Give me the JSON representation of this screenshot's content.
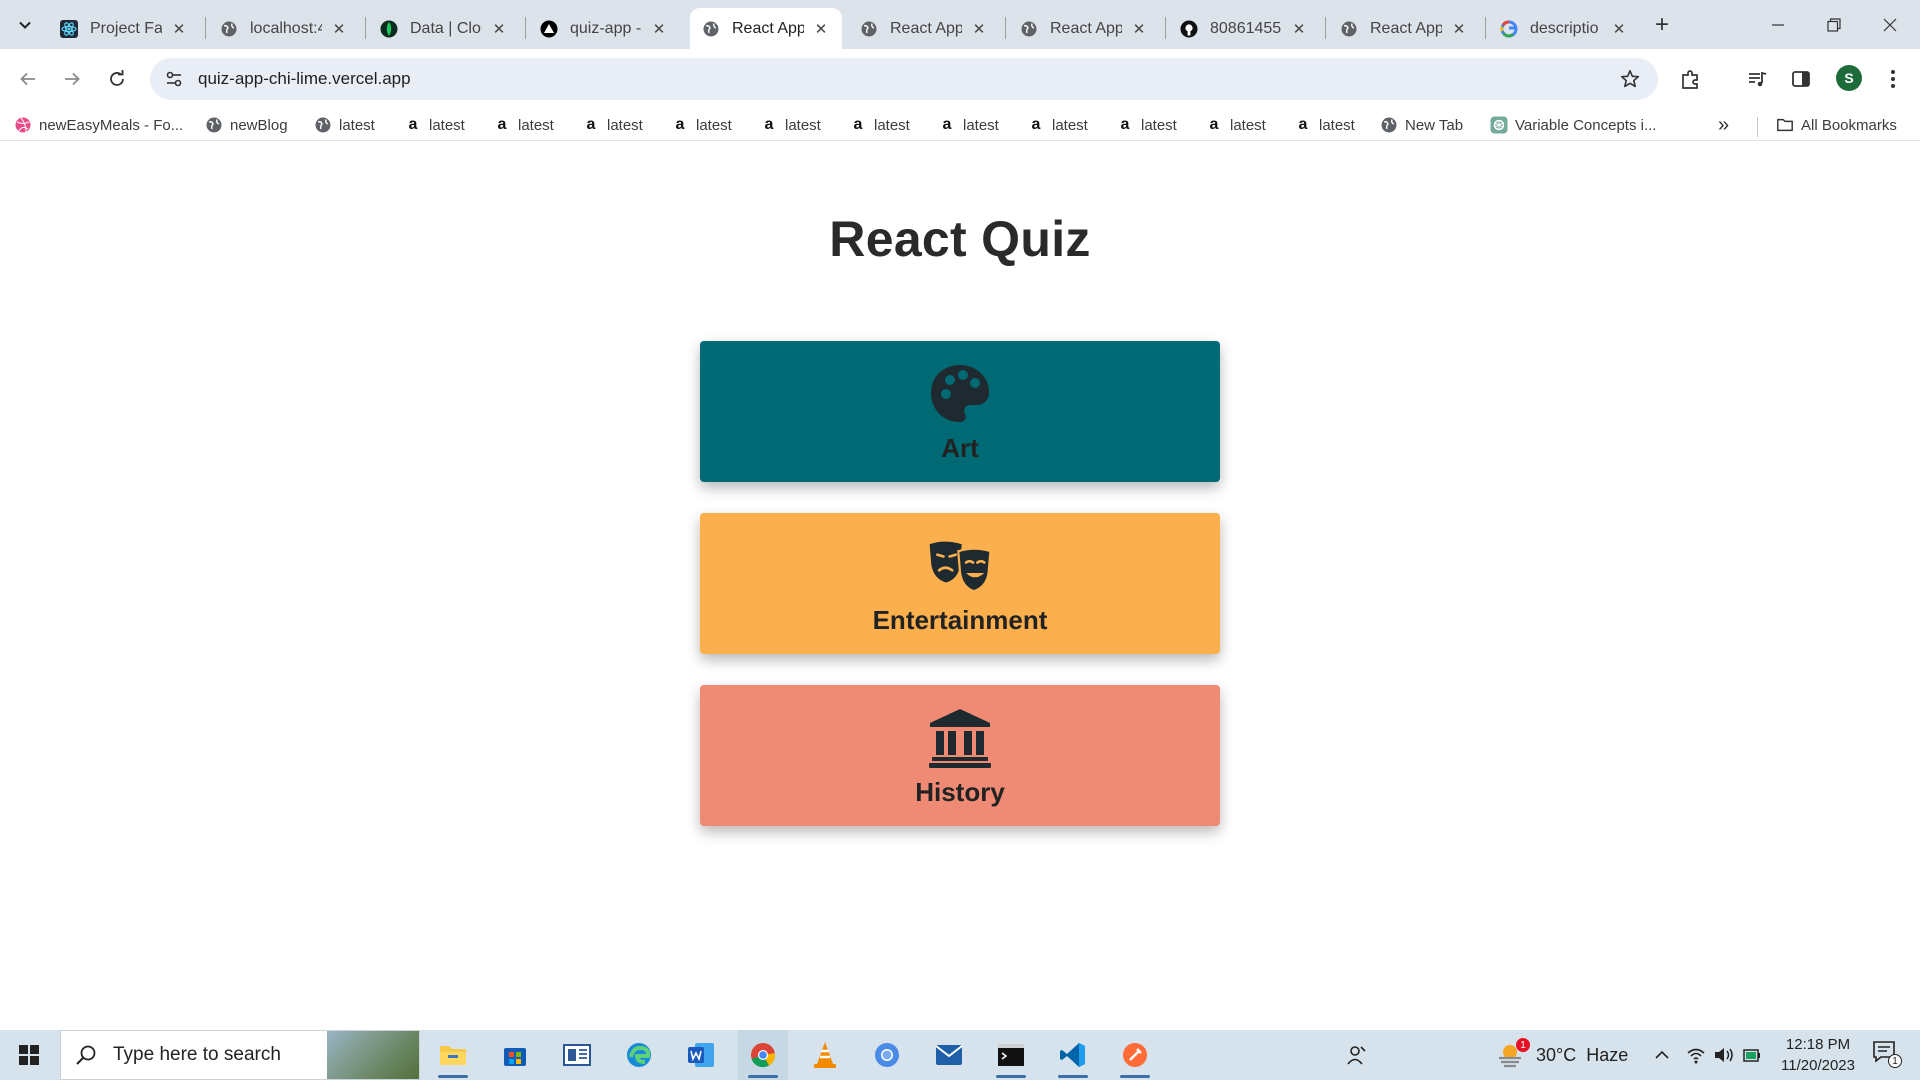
{
  "browser": {
    "tabs": [
      {
        "title": "Project Fai",
        "icon": "react-icon"
      },
      {
        "title": "localhost:4",
        "icon": "globe-icon"
      },
      {
        "title": "Data | Clou",
        "icon": "mongodb-leaf-icon"
      },
      {
        "title": "quiz-app -",
        "icon": "vercel-icon"
      },
      {
        "title": "React App",
        "icon": "globe-icon",
        "active": true
      },
      {
        "title": "React App",
        "icon": "globe-icon"
      },
      {
        "title": "React App",
        "icon": "globe-icon"
      },
      {
        "title": "80861455",
        "icon": "github-icon"
      },
      {
        "title": "React App",
        "icon": "globe-icon"
      },
      {
        "title": "descriptio",
        "icon": "google-icon"
      }
    ],
    "url": "quiz-app-chi-lime.vercel.app",
    "profile_initial": "S",
    "bookmarks": [
      {
        "label": "newEasyMeals - Fo...",
        "icon": "dribbble-icon"
      },
      {
        "label": "newBlog",
        "icon": "globe-icon"
      },
      {
        "label": "latest",
        "icon": "globe-icon"
      },
      {
        "label": "latest",
        "icon": "amazon-icon"
      },
      {
        "label": "latest",
        "icon": "amazon-icon"
      },
      {
        "label": "latest",
        "icon": "amazon-icon"
      },
      {
        "label": "latest",
        "icon": "amazon-icon"
      },
      {
        "label": "latest",
        "icon": "amazon-icon"
      },
      {
        "label": "latest",
        "icon": "amazon-icon"
      },
      {
        "label": "latest",
        "icon": "amazon-icon"
      },
      {
        "label": "latest",
        "icon": "amazon-icon"
      },
      {
        "label": "latest",
        "icon": "amazon-icon"
      },
      {
        "label": "latest",
        "icon": "amazon-icon"
      },
      {
        "label": "latest",
        "icon": "amazon-icon"
      },
      {
        "label": "New Tab",
        "icon": "globe-icon"
      },
      {
        "label": "Variable Concepts i...",
        "icon": "openai-icon"
      }
    ],
    "all_bookmarks_label": "All Bookmarks"
  },
  "page": {
    "title": "React Quiz",
    "categories": [
      {
        "label": "Art",
        "icon": "palette-icon",
        "color": "#006a74"
      },
      {
        "label": "Entertainment",
        "icon": "theater-masks-icon",
        "color": "#fbb04d"
      },
      {
        "label": "History",
        "icon": "landmark-icon",
        "color": "#ef8a74"
      }
    ]
  },
  "taskbar": {
    "search_placeholder": "Type here to search",
    "weather": "30°C  Haze",
    "weather_badge": "1",
    "time": "12:18 PM",
    "date": "11/20/2023",
    "notification_count": "1"
  }
}
